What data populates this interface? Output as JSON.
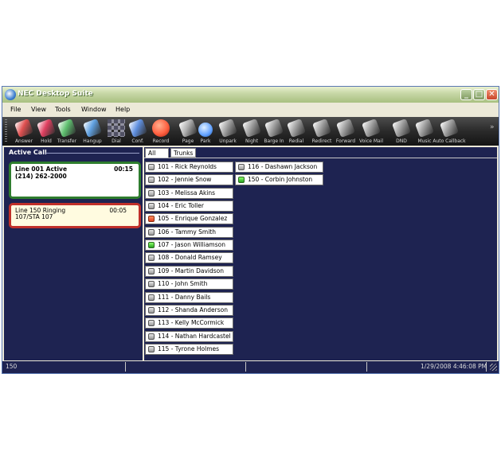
{
  "window": {
    "title": "NEC Desktop Suite",
    "minimize": "_",
    "maximize": "□",
    "close": "✕"
  },
  "menu": [
    "File",
    "View",
    "Tools",
    "Window",
    "Help"
  ],
  "toolbar": [
    {
      "label": "Answer",
      "icon": "answer-phone-icon",
      "color": "#e05050"
    },
    {
      "label": "Hold",
      "icon": "music-note-icon",
      "color": "#e04060"
    },
    {
      "label": "Transfer",
      "icon": "transfer-phone-icon",
      "color": "#60c070"
    },
    {
      "label": "Hangup",
      "icon": "hangup-phone-icon",
      "color": "#60a0e0"
    },
    {
      "label": "Dial",
      "icon": "dialpad-icon",
      "color": "#9090a0"
    },
    {
      "label": "Conf.",
      "icon": "conference-icon",
      "color": "#6090e0"
    },
    {
      "label": "Record",
      "icon": "record-icon",
      "color": "#ff6040"
    },
    {
      "label": "Page",
      "icon": "page-icon",
      "color": "#b0b0b0"
    },
    {
      "label": "Park",
      "icon": "park-icon",
      "color": "#60a0ff"
    },
    {
      "label": "Unpark",
      "icon": "unpark-icon",
      "color": "#a0a0a0"
    },
    {
      "label": "Night",
      "icon": "night-icon",
      "color": "#a0a0a0"
    },
    {
      "label": "Barge In",
      "icon": "barge-in-icon",
      "color": "#a0a0a0"
    },
    {
      "label": "Redial",
      "icon": "redial-icon",
      "color": "#a0a0a0"
    },
    {
      "label": "Redirect",
      "icon": "redirect-icon",
      "color": "#a0a0a0"
    },
    {
      "label": "Forward",
      "icon": "forward-icon",
      "color": "#a0a0a0"
    },
    {
      "label": "Voice Mail",
      "icon": "voicemail-icon",
      "color": "#a0a0a0"
    },
    {
      "label": "DND",
      "icon": "dnd-icon",
      "color": "#a0a0a0"
    },
    {
      "label": "Music",
      "icon": "music-icon",
      "color": "#a0a0a0"
    },
    {
      "label": "Auto Callback",
      "icon": "auto-callback-icon",
      "color": "#a0a0a0"
    }
  ],
  "active_call": {
    "header": "Active Call",
    "calls": [
      {
        "line1": "Line 001 Active",
        "line2": "(214) 262-2000",
        "timer": "00:15",
        "state": "active"
      },
      {
        "line1": "Line 150 Ringing",
        "line2": "107/STA 107",
        "timer": "00:05",
        "state": "ringing"
      }
    ]
  },
  "tabs": [
    "All",
    "Trunks"
  ],
  "extensions_col1": [
    {
      "label": "101 - Rick Reynolds",
      "status": "grey"
    },
    {
      "label": "102 - Jennie Snow",
      "status": "grey"
    },
    {
      "label": "103 - Melissa Akins",
      "status": "grey"
    },
    {
      "label": "104 - Eric Toller",
      "status": "grey"
    },
    {
      "label": "105 - Enrique Gonzalez",
      "status": "red"
    },
    {
      "label": "106 - Tammy Smith",
      "status": "grey"
    },
    {
      "label": "107 - Jason Williamson",
      "status": "green"
    },
    {
      "label": "108 - Donald Ramsey",
      "status": "grey"
    },
    {
      "label": "109 - Martin Davidson",
      "status": "grey"
    },
    {
      "label": "110 - John Smith",
      "status": "grey"
    },
    {
      "label": "111 - Danny Bails",
      "status": "grey"
    },
    {
      "label": "112 - Shanda Anderson",
      "status": "grey"
    },
    {
      "label": "113 - Kelly McCormick",
      "status": "grey"
    },
    {
      "label": "114 - Nathan Hardcastel",
      "status": "grey"
    },
    {
      "label": "115 - Tyrone Holmes",
      "status": "grey"
    }
  ],
  "extensions_col2": [
    {
      "label": "116 - Dashawn Jackson",
      "status": "grey"
    },
    {
      "label": "150 - Corbin Johnston",
      "status": "green"
    }
  ],
  "status_bar": {
    "left": "150",
    "datetime": "1/29/2008 4:46:08 PM"
  }
}
